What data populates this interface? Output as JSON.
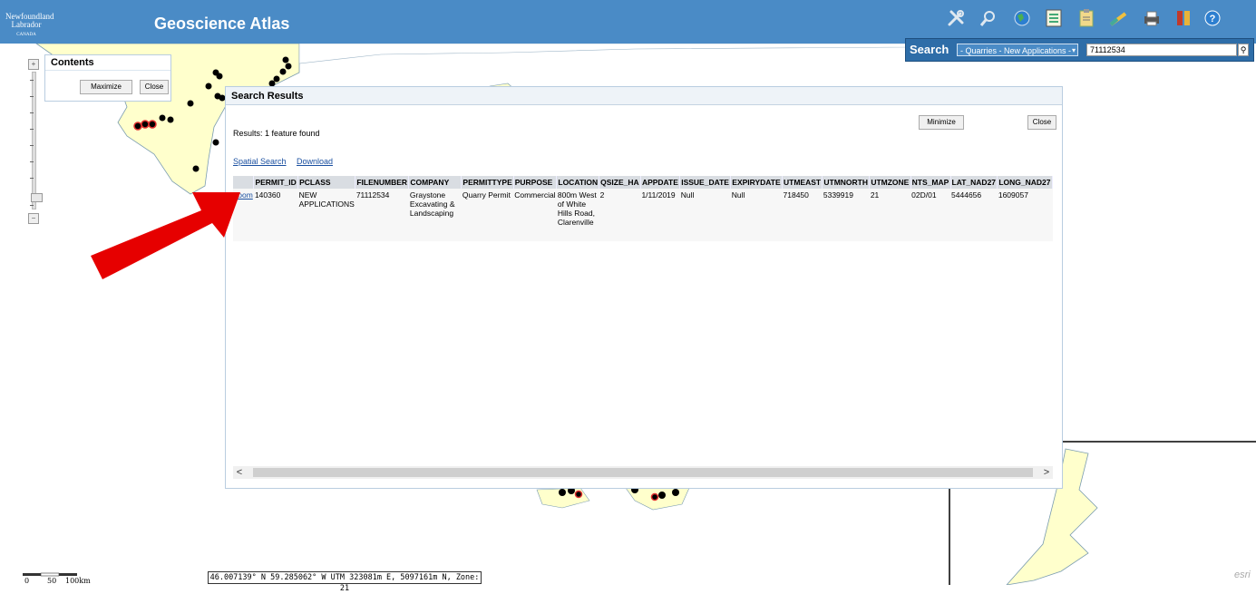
{
  "header": {
    "app_title": "Geoscience Atlas",
    "logo_line1": "Newfoundland",
    "logo_line2": "Labrador",
    "logo_line3": "CANADA"
  },
  "toolbar": {
    "icons": [
      "tools-icon",
      "search-tool-icon",
      "globe-icon",
      "layers-list-icon",
      "clipboard-icon",
      "measure-icon",
      "print-icon",
      "bookmark-icon",
      "help-icon"
    ]
  },
  "search": {
    "label": "Search",
    "layer_selected": "- Quarries - New Applications -",
    "query_value": "71112534"
  },
  "contents_panel": {
    "title": "Contents",
    "maximize_label": "Maximize",
    "close_label": "Close"
  },
  "results_panel": {
    "title": "Search Results",
    "minimize_label": "Minimize",
    "close_label": "Close",
    "results_text": "Results:  1 feature found",
    "spatial_search_label": "Spatial Search",
    "download_label": "Download",
    "columns": [
      "PERMIT_ID",
      "PCLASS",
      "FILENUMBER",
      "COMPANY",
      "PERMITTYPE",
      "PURPOSE",
      "LOCATION",
      "QSIZE_HA",
      "APPDATE",
      "ISSUE_DATE",
      "EXPIRYDATE",
      "UTMEAST",
      "UTMNORTH",
      "UTMZONE",
      "NTS_MAP",
      "LAT_NAD27",
      "LONG_NAD27"
    ],
    "row_link": "zoom",
    "row": [
      "140360",
      "NEW APPLICATIONS",
      "71112534",
      "Graystone Excavating & Landscaping",
      "Quarry Permit",
      "Commercial",
      "800m West of White Hills Road, Clarenville",
      "2",
      "1/11/2019",
      "Null",
      "Null",
      "718450",
      "5339919",
      "21",
      "02D/01",
      "5444656",
      "1609057"
    ]
  },
  "status": {
    "coordinates": "46.007139° N 59.285062° W UTM 323081m E, 5097161m N, Zone: 21",
    "scale_labels": [
      "0",
      "50",
      "100km"
    ],
    "attribution": "esri"
  },
  "colors": {
    "header_bg": "#4a8bc6",
    "land": "#ffffcc",
    "arrow": "#e60000",
    "point": "#000000",
    "highlight_point": "#e03030"
  }
}
